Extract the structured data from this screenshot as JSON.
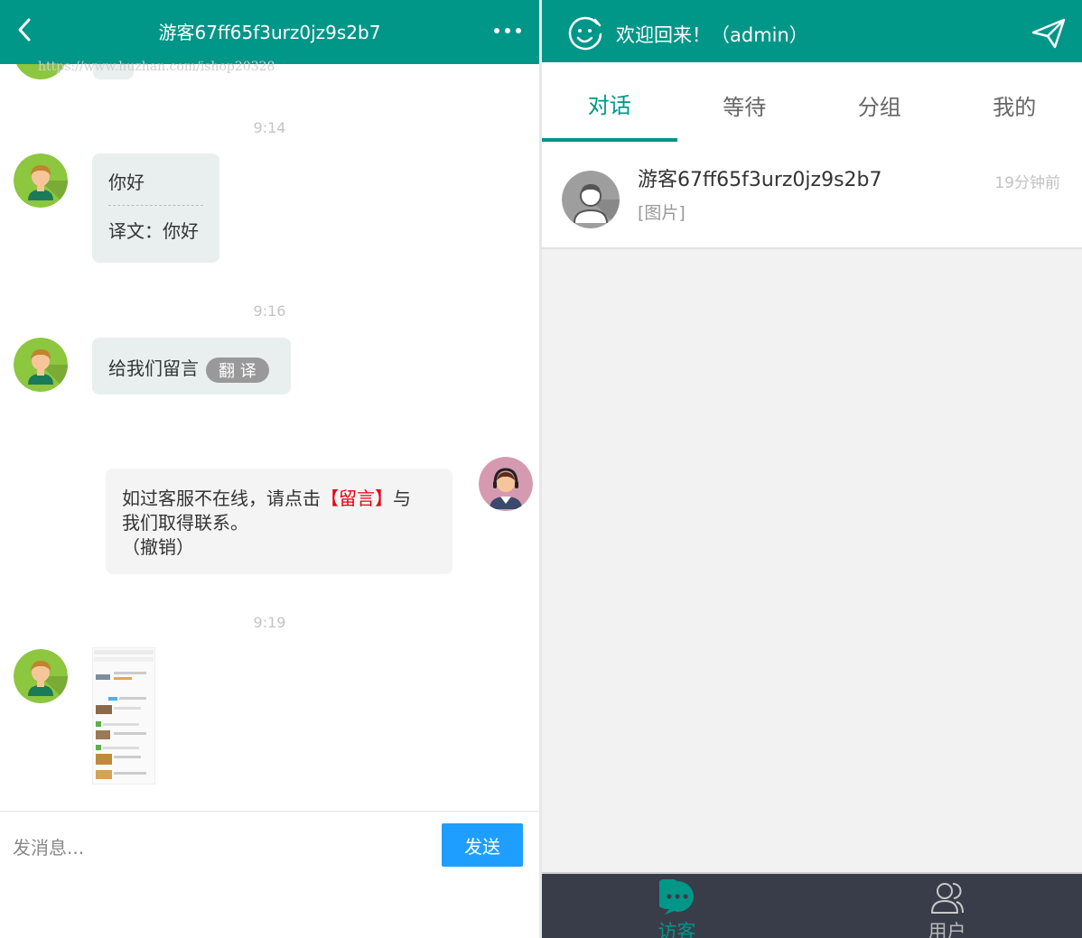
{
  "chat": {
    "title": "游客67ff65f3urz0jz9s2b7",
    "watermark": "https://www.huzhan.com/ishop20328"
  },
  "messages": {
    "time1": "9:14",
    "msg1_text": "你好",
    "msg1_translation": "译文：你好",
    "time2": "9:16",
    "msg2_text": "给我们留言",
    "msg2_translate_btn": "翻 译",
    "msg3_line1_pre": "如过客服不在线，请点击",
    "msg3_link": "【留言】",
    "msg3_line1_post": "与",
    "msg3_line2": "我们取得联系。",
    "msg3_recall": "（撤销）",
    "time3": "9:19"
  },
  "input": {
    "placeholder": "发消息...",
    "send_label": "发送"
  },
  "admin": {
    "welcome": "欢迎回来！（admin）",
    "tabs": [
      "对话",
      "等待",
      "分组",
      "我的"
    ],
    "active_tab": 0
  },
  "conversations": [
    {
      "name": "游客67ff65f3urz0jz9s2b7",
      "preview": "[图片]",
      "time": "19分钟前"
    }
  ],
  "bottom_nav": [
    "访客",
    "用户"
  ],
  "colors": {
    "primary": "#009688",
    "send_button": "#1e9fff",
    "bubble_bg": "#e9efef",
    "nav_bg": "#393d49",
    "link_red": "#e60012"
  }
}
